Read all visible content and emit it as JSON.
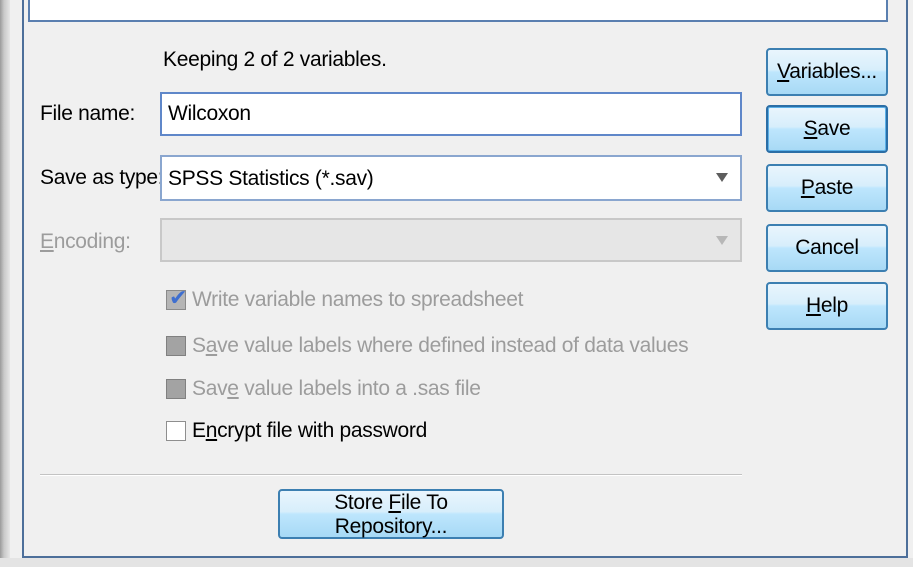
{
  "dialog": {
    "keeping_status": "Keeping 2 of 2 variables.",
    "file_name": {
      "label": "File name:",
      "value": "Wilcoxon"
    },
    "save_as_type": {
      "label": "Save as type:",
      "value": "SPSS Statistics (*.sav)"
    },
    "encoding": {
      "label_underlined": "E",
      "label_rest": "ncoding:",
      "value": ""
    },
    "options": [
      {
        "pre": "",
        "u": "",
        "post": "Write variable names to spreadsheet",
        "checked": true,
        "enabled": false
      },
      {
        "pre": "S",
        "u": "a",
        "post": "ve value labels where defined instead of data values",
        "checked": false,
        "enabled": false
      },
      {
        "pre": "Sav",
        "u": "e",
        "post": " value labels into a .sas file",
        "checked": false,
        "enabled": false
      },
      {
        "pre": "E",
        "u": "n",
        "post": "crypt file with password",
        "checked": false,
        "enabled": true
      }
    ],
    "buttons": {
      "variables": {
        "u": "V",
        "rest": "ariables..."
      },
      "save": {
        "u": "S",
        "rest": "ave"
      },
      "paste": {
        "u": "P",
        "rest": "aste"
      },
      "cancel": {
        "label": "Cancel"
      },
      "help": {
        "u": "H",
        "rest": "elp"
      },
      "store": {
        "pre": "Store ",
        "u": "F",
        "post": "ile To Repository..."
      }
    }
  }
}
